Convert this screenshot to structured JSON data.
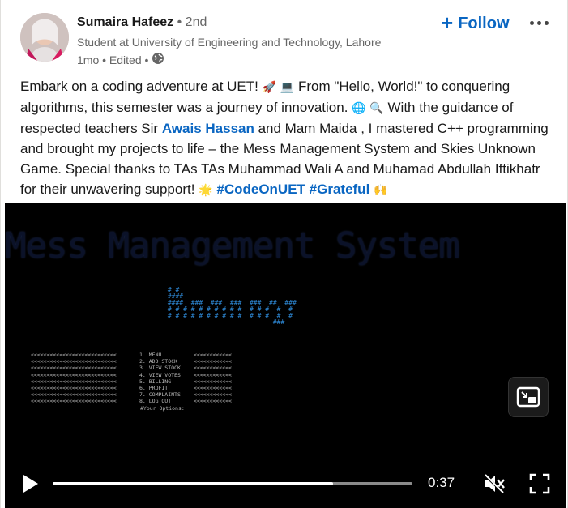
{
  "author": {
    "name": "Sumaira Hafeez",
    "degree": "• 2nd",
    "headline": "Student at University of Engineering and Technology, Lahore",
    "meta": "1mo • Edited •"
  },
  "actions": {
    "follow_label": "Follow",
    "more_icon": "more-horizontal-icon"
  },
  "post": {
    "p1": "Embark on a coding adventure at UET!",
    "p2": "From \"Hello, World!\" to conquering algorithms, this semester was a journey of innovation.",
    "p3": "With the guidance of respected teachers Sir",
    "mention1": "Awais Hassan",
    "p4": "and Mam Maida , I mastered C++ programming and brought my projects to life – the Mess Management System and Skies Unknown Game. Special thanks to TAs TAs Muhammad Wali A and Muhamad Abdullah Iftikhatr for their unwavering support!",
    "hashtag1": "#CodeOnUET",
    "hashtag2": "#Grateful",
    "emojis": [
      "🚀",
      "💻",
      "🌐",
      "🔍",
      "🌟",
      "🙌"
    ]
  },
  "video": {
    "title_text": "Mess Management System",
    "menu_items": [
      "1. MENU",
      "2. ADD STOCK",
      "3. VIEW STOCK",
      "4. VIEW VOTES",
      "5. BILLING",
      "6. PROFIT",
      "7. COMPLAINTS",
      "8. LOG OUT",
      "#Your Options:"
    ],
    "time": "0:37",
    "progress": 0.78
  }
}
